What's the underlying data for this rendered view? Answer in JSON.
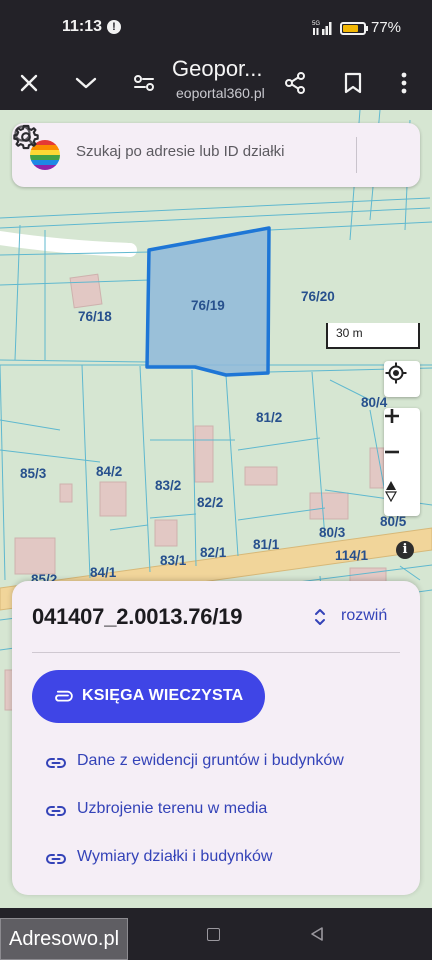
{
  "status_bar": {
    "time": "11:13",
    "notification_badge": "!",
    "battery_percent": "77%",
    "battery_level": 0.77
  },
  "browser": {
    "title": "Geopor...",
    "url": "eoportal360.pl"
  },
  "search": {
    "placeholder": "Szukaj po adresie lub ID działki"
  },
  "map": {
    "scale_label": "30 m",
    "parcel_labels": [
      "76/19",
      "76/18",
      "76/20",
      "81/2",
      "80/4",
      "85/3",
      "84/2",
      "83/2",
      "82/2",
      "80/3",
      "80/5",
      "114/1",
      "83/1",
      "82/1",
      "81/1",
      "85/2",
      "84/1"
    ],
    "selected_parcel_color": "#8fb9da",
    "selected_parcel_border": "#1e76d6"
  },
  "sheet": {
    "parcel_id": "041407_2.0013.76/19",
    "expand_label": "rozwiń",
    "primary_button": "KSIĘGA WIECZYSTA",
    "links": [
      "Dane z ewidencji gruntów i budynków",
      "Uzbrojenie terenu w media",
      "Wymiary działki i budynków"
    ]
  },
  "watermark": "Adresowo.pl",
  "colors": {
    "accent": "#3f45e6",
    "link": "#3443b8",
    "map_background": "#d6e6d2",
    "road": "#f1d59a"
  }
}
